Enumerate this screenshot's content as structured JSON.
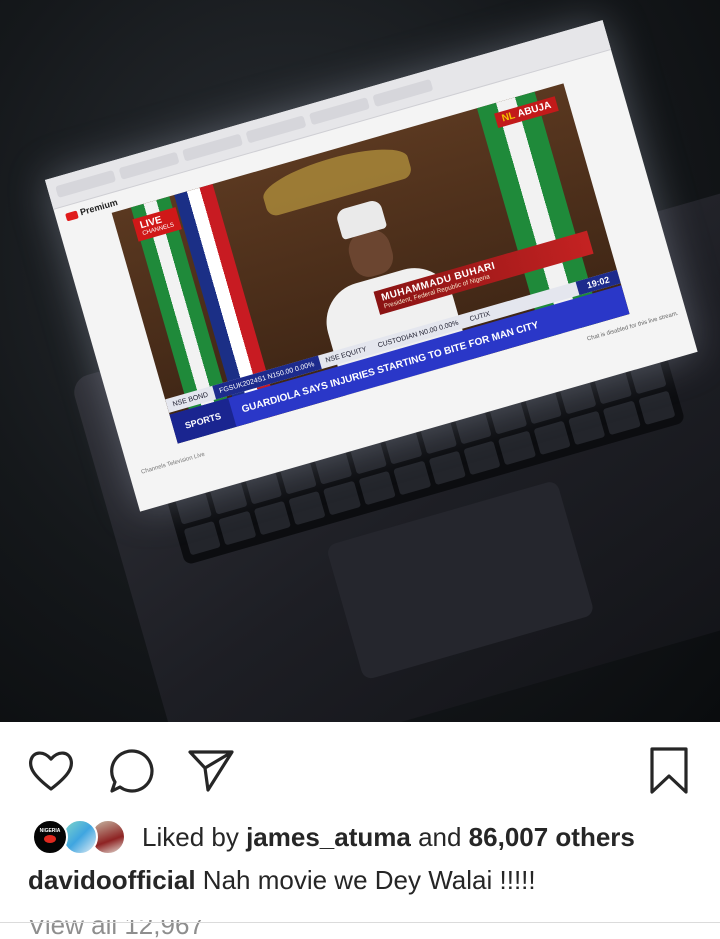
{
  "photo": {
    "description_labels": {
      "live_badge": "LIVE",
      "live_badge_sub": "CHANNELS",
      "station_badge": "ABUJA",
      "station_badge_prefix": "NL",
      "yt_brand": "Premium",
      "speaker_name": "MUHAMMADU BUHARI",
      "speaker_role": "President, Federal Republic of Nigeria",
      "ticker_left": "NSE BOND",
      "ticker_code": "FGSUK2024S1 N150.00 0.00%",
      "ticker_mid": "NSE EQUITY",
      "ticker_mid2": "CUSTODIAN N0.00 0.00%",
      "ticker_right": "CUTIX",
      "clock": "19:02",
      "news_category": "SPORTS",
      "news_headline": "GUARDIOLA SAYS INJURIES STARTING TO BITE FOR MAN CITY",
      "chat_note": "Chat is disabled for this live stream.",
      "video_title": "Channels Television Live"
    }
  },
  "actions": {
    "like": "heart-icon",
    "comment": "comment-icon",
    "share": "paper-plane-icon",
    "save": "bookmark-icon"
  },
  "likes": {
    "prefix": "Liked by ",
    "user": "james_atuma",
    "middle": " and ",
    "count": "86,007 others"
  },
  "avatar_text": "NIGERIA",
  "caption": {
    "username": "davidoofficial",
    "text": " Nah movie we Dey Walai !!!!!"
  },
  "comments_cutoff": "View all 12,967"
}
